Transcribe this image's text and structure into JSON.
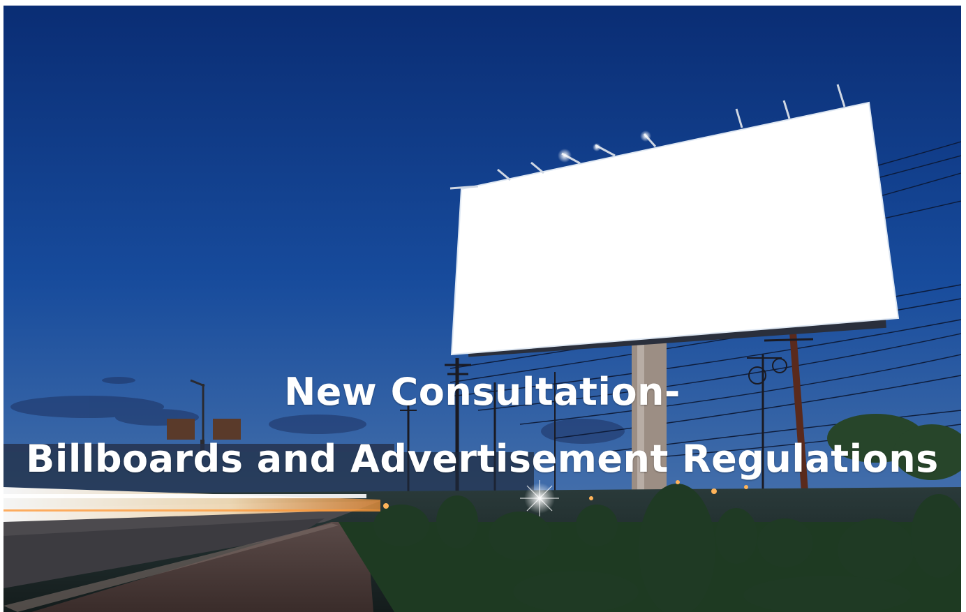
{
  "headline": {
    "line1": "New Consultation-",
    "line2": "Billboards and Advertisement Regulations"
  },
  "colors": {
    "sky_top": "#0b2f78",
    "sky_bottom": "#3f6fae",
    "billboard_face": "#ffffff",
    "text": "#ffffff"
  },
  "scene_elements": [
    "night-sky",
    "blank-billboard",
    "flood-lights",
    "power-lines",
    "utility-poles",
    "street-lamp",
    "light-trails",
    "road",
    "brick-sidewalk",
    "hedges"
  ]
}
